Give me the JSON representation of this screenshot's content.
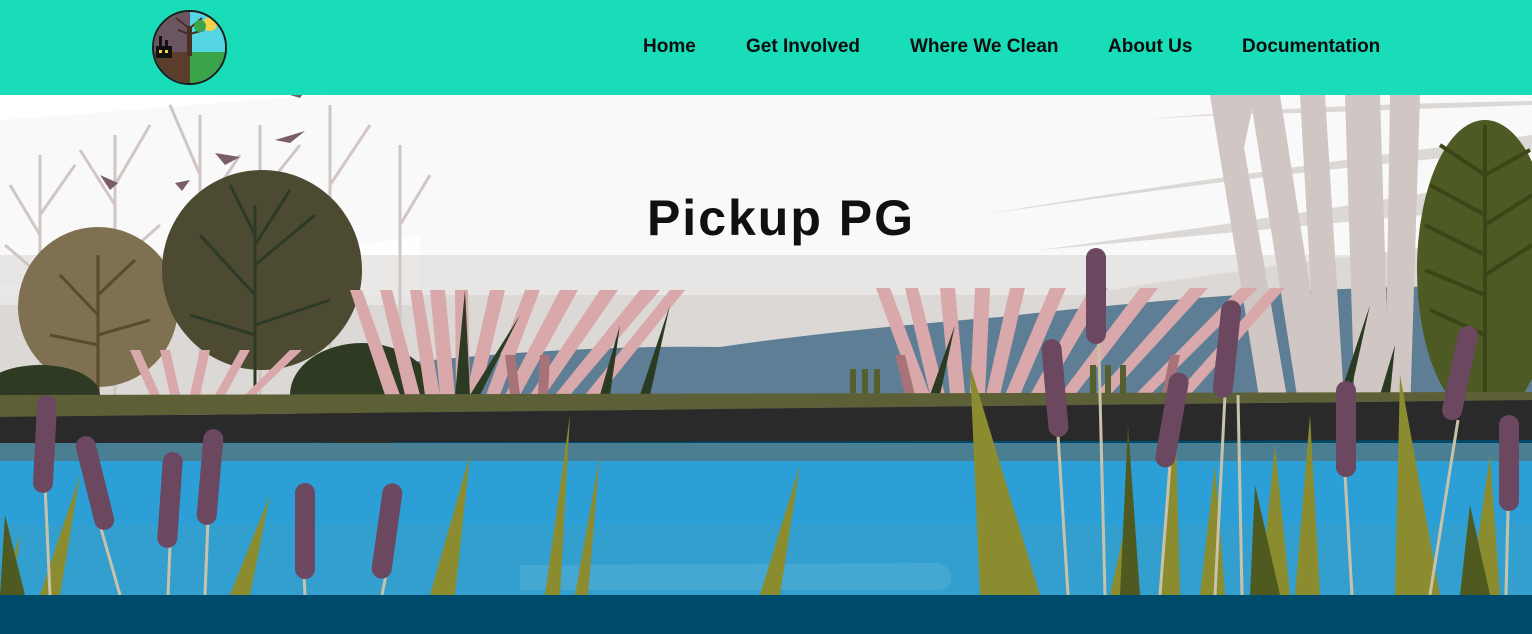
{
  "header": {
    "logo_icon": "tree-factory-logo-icon",
    "nav": [
      {
        "label": "Home"
      },
      {
        "label": "Get Involved"
      },
      {
        "label": "Where We Clean"
      },
      {
        "label": "About Us"
      },
      {
        "label": "Documentation"
      }
    ]
  },
  "hero": {
    "title": "Pickup PG",
    "illustration": "river-landscape-illustration"
  },
  "colors": {
    "nav_background": "#19dcb9",
    "footer_band": "#004a6b",
    "water": "#2c9fd6",
    "sky": "#dcd8d5"
  }
}
